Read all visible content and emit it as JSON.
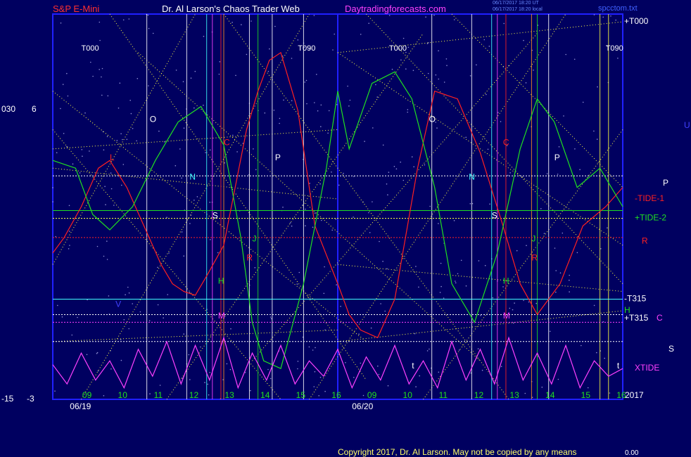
{
  "header": {
    "symbol": "S&P E-Mini",
    "site": "Dr. Al Larson's Chaos Trader Web",
    "url": "Daytradingforecasts.com",
    "stamp1": "06/17/2017 18:20 UT",
    "stamp2": "06/17/2017 18:20 local",
    "file": "spcctom.txt"
  },
  "left_axis": {
    "a": "030",
    "b": "6",
    "c": "-15",
    "d": "-3"
  },
  "footer": {
    "copyright": "Copyright 2017, Dr. Al Larson. May not be copied by any means",
    "value": "0.00"
  },
  "colors": {
    "background": "#000060",
    "frame": "#2020ff",
    "red": "#ff2020",
    "green": "#20e020",
    "magenta": "#ff40ff",
    "yellow": "#ffff40",
    "cyan": "#40ffff",
    "white": "#ffffff"
  },
  "chart_data": {
    "type": "line",
    "x_days": [
      "06/19",
      "06/20"
    ],
    "x_hours": [
      "09",
      "10",
      "11",
      "12",
      "13",
      "14",
      "15",
      "16",
      "09",
      "10",
      "11",
      "12",
      "13",
      "14",
      "15",
      "16"
    ],
    "year_label": "2017",
    "right_labels": [
      {
        "text": "+T000",
        "color": "#ffffff",
        "y": 0.0
      },
      {
        "text": "U",
        "color": "#4040ff",
        "y": 0.27
      },
      {
        "text": "P",
        "color": "#ffffff",
        "y": 0.42
      },
      {
        "text": "-TIDE-1",
        "color": "#ff2020",
        "y": 0.46
      },
      {
        "text": "+TIDE-2",
        "color": "#20e020",
        "y": 0.51
      },
      {
        "text": "R",
        "color": "#ff2020",
        "y": 0.57
      },
      {
        "text": "-T315",
        "color": "#ffffff",
        "y": 0.72
      },
      {
        "text": "H",
        "color": "#20e020",
        "y": 0.75
      },
      {
        "text": "+T315",
        "color": "#ffffff",
        "y": 0.77
      },
      {
        "text": "C",
        "color": "#ff40ff",
        "y": 0.77
      },
      {
        "text": "S",
        "color": "#ffffff",
        "y": 0.85
      },
      {
        "text": "XTIDE",
        "color": "#ff40ff",
        "y": 0.9
      }
    ],
    "top_labels": [
      {
        "text": "T000",
        "x": 0.05
      },
      {
        "text": "T090",
        "x": 0.43
      },
      {
        "text": "T000",
        "x": 0.59
      },
      {
        "text": "T090",
        "x": 0.97
      }
    ],
    "markers": [
      {
        "text": "O",
        "color": "#ffffff",
        "x": 0.17,
        "y": 0.28
      },
      {
        "text": "L",
        "color": "#ff2020",
        "x": 0.1,
        "y": 0.38
      },
      {
        "text": "N",
        "color": "#40ffff",
        "x": 0.24,
        "y": 0.43
      },
      {
        "text": "C",
        "color": "#ff2020",
        "x": 0.3,
        "y": 0.34
      },
      {
        "text": "P",
        "color": "#ffffff",
        "x": 0.39,
        "y": 0.38
      },
      {
        "text": "S",
        "color": "#ffffff",
        "x": 0.28,
        "y": 0.53
      },
      {
        "text": "J",
        "color": "#20e020",
        "x": 0.35,
        "y": 0.59
      },
      {
        "text": "R",
        "color": "#ff2020",
        "x": 0.34,
        "y": 0.64
      },
      {
        "text": "H",
        "color": "#20e020",
        "x": 0.29,
        "y": 0.7
      },
      {
        "text": "V",
        "color": "#4040ff",
        "x": 0.11,
        "y": 0.76
      },
      {
        "text": "M",
        "color": "#ff40ff",
        "x": 0.29,
        "y": 0.79
      },
      {
        "text": "O",
        "color": "#ffffff",
        "x": 0.66,
        "y": 0.28
      },
      {
        "text": "N",
        "color": "#40ffff",
        "x": 0.73,
        "y": 0.43
      },
      {
        "text": "C",
        "color": "#ff2020",
        "x": 0.79,
        "y": 0.34
      },
      {
        "text": "P",
        "color": "#ffffff",
        "x": 0.88,
        "y": 0.38
      },
      {
        "text": "S",
        "color": "#ffffff",
        "x": 0.77,
        "y": 0.53
      },
      {
        "text": "J",
        "color": "#20e020",
        "x": 0.84,
        "y": 0.59
      },
      {
        "text": "R",
        "color": "#ff2020",
        "x": 0.84,
        "y": 0.64
      },
      {
        "text": "H",
        "color": "#20e020",
        "x": 0.79,
        "y": 0.7
      },
      {
        "text": "M",
        "color": "#ff40ff",
        "x": 0.79,
        "y": 0.79
      },
      {
        "text": "t",
        "color": "#ffffff",
        "x": 0.63,
        "y": 0.92
      },
      {
        "text": "t",
        "color": "#ffffff",
        "x": 0.99,
        "y": 0.92
      }
    ],
    "series": [
      {
        "name": "TIDE-1",
        "color": "#ff2020",
        "x": [
          0,
          0.02,
          0.05,
          0.08,
          0.1,
          0.13,
          0.16,
          0.19,
          0.21,
          0.23,
          0.25,
          0.27,
          0.3,
          0.34,
          0.36,
          0.38,
          0.4,
          0.43,
          0.46,
          0.5,
          0.52,
          0.54,
          0.57,
          0.6,
          0.64,
          0.67,
          0.71,
          0.75,
          0.79,
          0.82,
          0.85,
          0.89,
          0.93,
          0.97,
          1.0
        ],
        "y": [
          0.62,
          0.58,
          0.5,
          0.4,
          0.38,
          0.45,
          0.55,
          0.65,
          0.7,
          0.72,
          0.73,
          0.68,
          0.6,
          0.3,
          0.2,
          0.12,
          0.1,
          0.25,
          0.55,
          0.7,
          0.78,
          0.82,
          0.84,
          0.74,
          0.4,
          0.2,
          0.22,
          0.36,
          0.55,
          0.7,
          0.78,
          0.7,
          0.55,
          0.5,
          0.45
        ]
      },
      {
        "name": "TIDE-2",
        "color": "#20e020",
        "x": [
          0,
          0.04,
          0.07,
          0.1,
          0.14,
          0.18,
          0.22,
          0.26,
          0.3,
          0.33,
          0.35,
          0.37,
          0.4,
          0.44,
          0.48,
          0.5,
          0.52,
          0.56,
          0.6,
          0.63,
          0.67,
          0.7,
          0.74,
          0.78,
          0.82,
          0.85,
          0.88,
          0.92,
          0.96,
          1.0
        ],
        "y": [
          0.38,
          0.4,
          0.52,
          0.56,
          0.5,
          0.38,
          0.28,
          0.24,
          0.34,
          0.58,
          0.8,
          0.9,
          0.92,
          0.7,
          0.4,
          0.2,
          0.35,
          0.18,
          0.15,
          0.22,
          0.45,
          0.7,
          0.8,
          0.62,
          0.35,
          0.22,
          0.28,
          0.45,
          0.4,
          0.5
        ]
      },
      {
        "name": "XTIDE",
        "color": "#ff40ff",
        "x": [
          0,
          0.025,
          0.05,
          0.075,
          0.1,
          0.125,
          0.15,
          0.175,
          0.2,
          0.225,
          0.25,
          0.275,
          0.3,
          0.325,
          0.35,
          0.375,
          0.4,
          0.425,
          0.45,
          0.475,
          0.5,
          0.525,
          0.55,
          0.575,
          0.6,
          0.625,
          0.65,
          0.675,
          0.7,
          0.725,
          0.75,
          0.775,
          0.8,
          0.825,
          0.85,
          0.875,
          0.9,
          0.925,
          0.95,
          0.975,
          1.0
        ],
        "y": [
          0.91,
          0.96,
          0.88,
          0.95,
          0.9,
          0.97,
          0.87,
          0.94,
          0.85,
          0.96,
          0.86,
          0.95,
          0.84,
          0.97,
          0.88,
          0.95,
          0.86,
          0.96,
          0.9,
          0.94,
          0.87,
          0.97,
          0.89,
          0.95,
          0.86,
          0.96,
          0.9,
          0.97,
          0.85,
          0.95,
          0.87,
          0.96,
          0.84,
          0.95,
          0.88,
          0.96,
          0.86,
          0.97,
          0.9,
          0.94,
          0.92
        ]
      }
    ],
    "h_lines": [
      {
        "color": "#ffffff",
        "style": "dotted",
        "y": 0.42
      },
      {
        "color": "#20e020",
        "style": "solid",
        "y": 0.51
      },
      {
        "color": "#ff2020",
        "style": "dotted",
        "y": 0.58
      },
      {
        "color": "#ffff40",
        "style": "dotted",
        "y": 0.53
      },
      {
        "color": "#40ffff",
        "style": "solid",
        "y": 0.74
      },
      {
        "color": "#ff40ff",
        "style": "dotted",
        "y": 0.8
      },
      {
        "color": "#ffffff",
        "style": "dotted",
        "y": 0.78
      },
      {
        "color": "#ffffff",
        "style": "dotted",
        "y": 0.85
      }
    ]
  }
}
